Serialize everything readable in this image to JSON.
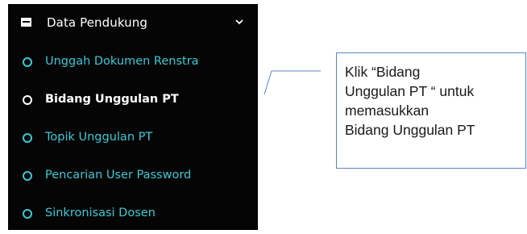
{
  "sidebar": {
    "section": {
      "icon": "archive-box-icon",
      "label": "Data Pendukung",
      "chevron_icon": "chevron-down-icon"
    },
    "items": [
      {
        "label": "Unggah Dokumen Renstra",
        "icon": "circle-outline-icon",
        "active": false
      },
      {
        "label": "Bidang Unggulan PT",
        "icon": "circle-outline-icon",
        "active": true
      },
      {
        "label": "Topik Unggulan PT",
        "icon": "circle-outline-icon",
        "active": false
      },
      {
        "label": "Pencarian User Password",
        "icon": "circle-outline-icon",
        "active": false
      },
      {
        "label": "Sinkronisasi Dosen",
        "icon": "circle-outline-icon",
        "active": false
      }
    ]
  },
  "callout": {
    "lines": [
      "Klik “Bidang",
      "Unggulan PT “ untuk",
      "memasukkan",
      "Bidang Unggulan PT"
    ]
  },
  "colors": {
    "sidebar_bg": "#050505",
    "item_text": "#3fc8d6",
    "active_text": "#ffffff",
    "callout_border": "#5b84c4"
  }
}
